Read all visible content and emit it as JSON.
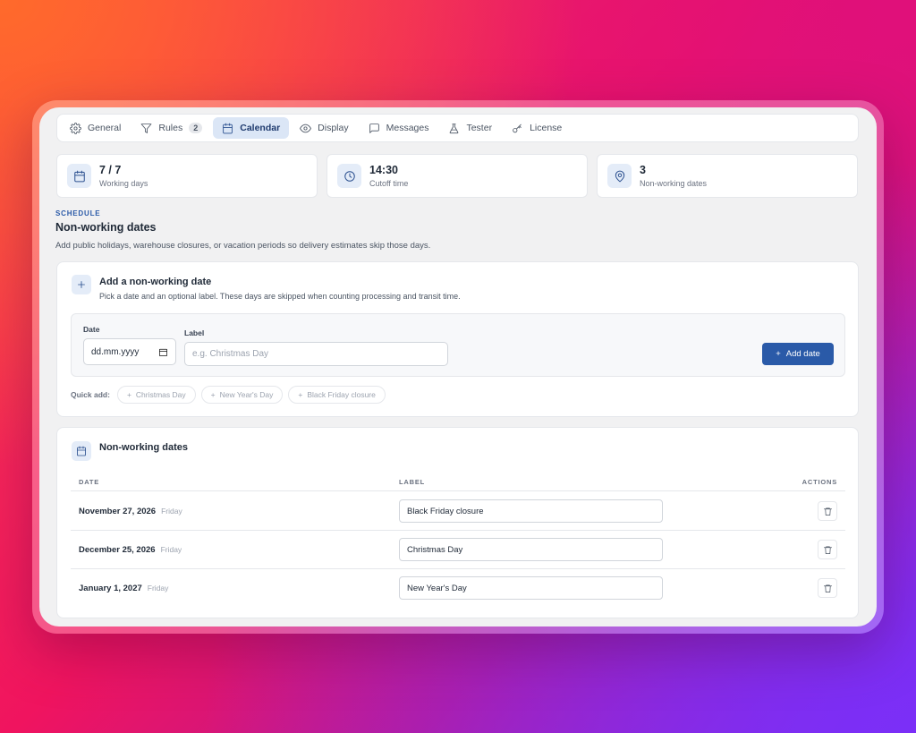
{
  "tabs": [
    {
      "label": "General",
      "icon": "gear-icon"
    },
    {
      "label": "Rules",
      "icon": "filter-icon",
      "badge": "2"
    },
    {
      "label": "Calendar",
      "icon": "calendar-icon",
      "active": true
    },
    {
      "label": "Display",
      "icon": "eye-icon"
    },
    {
      "label": "Messages",
      "icon": "message-icon"
    },
    {
      "label": "Tester",
      "icon": "flask-icon"
    },
    {
      "label": "License",
      "icon": "key-icon"
    }
  ],
  "stats": [
    {
      "value": "7 / 7",
      "label": "Working days",
      "icon": "calendar-icon"
    },
    {
      "value": "14:30",
      "label": "Cutoff time",
      "icon": "clock-icon"
    },
    {
      "value": "3",
      "label": "Non-working dates",
      "icon": "map-pin-icon"
    }
  ],
  "section": {
    "eyebrow": "SCHEDULE",
    "title": "Non-working dates",
    "subtitle": "Add public holidays, warehouse closures, or vacation periods so delivery estimates skip those days."
  },
  "add_card": {
    "title": "Add a non-working date",
    "description": "Pick a date and an optional label. These days are skipped when counting processing and transit time.",
    "date_label": "Date",
    "date_placeholder": "dd.mm.yyyy",
    "label_label": "Label",
    "label_placeholder": "e.g. Christmas Day",
    "add_button": "Add date",
    "quick_add_label": "Quick add:",
    "quick_add": [
      "Christmas Day",
      "New Year's Day",
      "Black Friday closure"
    ]
  },
  "list_card": {
    "title": "Non-working dates",
    "columns": {
      "date": "DATE",
      "label": "LABEL",
      "actions": "ACTIONS"
    },
    "rows": [
      {
        "date": "November 27, 2026",
        "day": "Friday",
        "label": "Black Friday closure"
      },
      {
        "date": "December 25, 2026",
        "day": "Friday",
        "label": "Christmas Day"
      },
      {
        "date": "January 1, 2027",
        "day": "Friday",
        "label": "New Year's Day"
      }
    ]
  },
  "colors": {
    "accent": "#2a5aa8",
    "active_tab_bg": "#dbe6f6"
  }
}
